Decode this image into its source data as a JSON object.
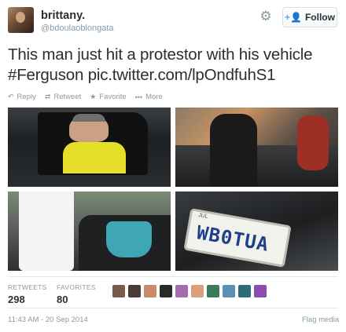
{
  "author": {
    "display_name": "brittany.",
    "handle": "@bdoulaoblongata"
  },
  "header": {
    "follow_label": "Follow",
    "follow_icon": "add-person-icon",
    "gear_icon": "gear-icon"
  },
  "tweet": {
    "text_line1": "This man just hit a protestor with his vehicle",
    "text_line2": "#Ferguson pic.twitter.com/lpOndfuhS1"
  },
  "actions": {
    "reply": "Reply",
    "retweet": "Retweet",
    "favorite": "Favorite",
    "more": "More"
  },
  "photos": {
    "plate_text": "WB0TUA"
  },
  "stats": {
    "retweets_label": "RETWEETS",
    "retweets_value": "298",
    "favorites_label": "FAVORITES",
    "favorites_value": "80"
  },
  "footer": {
    "timestamp": "11:43 AM - 20 Sep 2014",
    "flag_media": "Flag media"
  },
  "colors": {
    "accent": "#55acee",
    "text": "#292f33",
    "muted": "#8899a6",
    "favoriter_avatars": [
      "#7a5a4a",
      "#4b3b35",
      "#c98a6a",
      "#2a2a2a",
      "#a46bb2",
      "#d9a07a",
      "#3a7c5a",
      "#5b8fb5",
      "#2b6e7a",
      "#8c4bb0"
    ]
  }
}
